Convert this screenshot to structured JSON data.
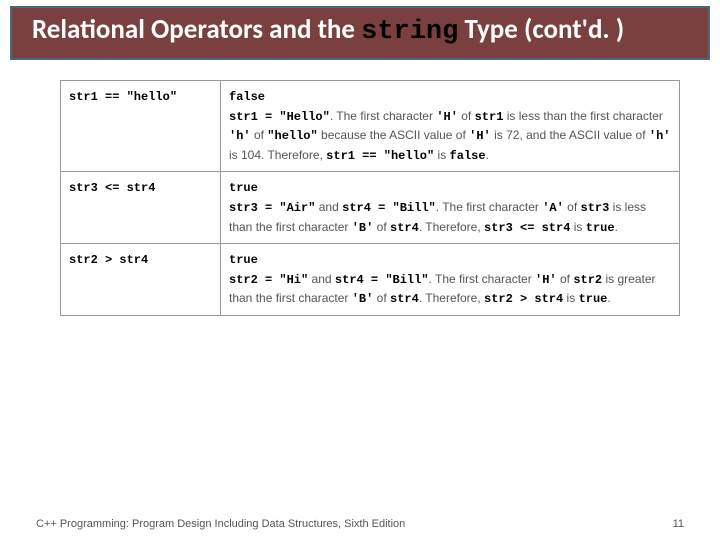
{
  "header": {
    "prefix": "Relational Operators and the ",
    "mono": "string",
    "suffix": " Type (cont'd. )"
  },
  "rows": [
    {
      "expr": "str1 == \"hello\"",
      "result": "false",
      "ex_p1": ". The first character ",
      "ex_v1": "'H'",
      "ex_p2": " of ",
      "ex_v2": "str1",
      "ex_p3": " is less than the first character ",
      "ex_v3": "'h'",
      "ex_p4": " of ",
      "ex_v4": "\"hello\"",
      "ex_p5": " because the ASCII value of ",
      "ex_v5": "'H'",
      "ex_p6": " is 72, and the ASCII value of ",
      "ex_v6": "'h'",
      "ex_p7": " is 104. Therefore, ",
      "ex_v7": "str1 == \"hello\"",
      "ex_p8": " is ",
      "ex_v8": "false",
      "ex_p9": ".",
      "assign": "str1 = \"Hello\""
    },
    {
      "expr": "str3 <= str4",
      "result": "true",
      "ex_p1a": " and ",
      "ex_p1": ". The first character ",
      "ex_v1": "'A'",
      "ex_p2": " of ",
      "ex_v2": "str3",
      "ex_p3": " is less than the first character ",
      "ex_v3": "'B'",
      "ex_p4": " of ",
      "ex_v4": "str4",
      "ex_p5": ". Therefore, ",
      "ex_v7": "str3 <= str4",
      "ex_p8": " is ",
      "ex_v8": "true",
      "ex_p9": ".",
      "assignA": "str3 = \"Air\"",
      "assignB": "str4 = \"Bill\""
    },
    {
      "expr": "str2 > str4",
      "result": "true",
      "ex_p1a": " and ",
      "ex_p1": ". The first character ",
      "ex_v1": "'H'",
      "ex_p2": " of ",
      "ex_v2": "str2",
      "ex_p3": " is greater than the first character ",
      "ex_v3": "'B'",
      "ex_p4": " of ",
      "ex_v4": "str4",
      "ex_p5": ". Therefore, ",
      "ex_v7": "str2 > str4",
      "ex_p8": " is ",
      "ex_v8": "true",
      "ex_p9": ".",
      "assignA": "str2 = \"Hi\"",
      "assignB": "str4 = \"Bill\""
    }
  ],
  "footer": {
    "text": "C++ Programming: Program Design Including Data Structures, Sixth Edition",
    "page": "11"
  }
}
